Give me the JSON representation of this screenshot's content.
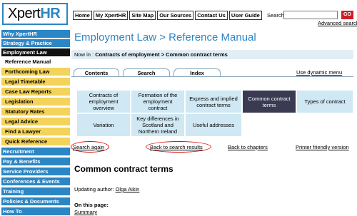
{
  "header": {
    "logo_prefix": "Xpert",
    "logo_suffix": "HR",
    "nav": [
      "Home",
      "My XpertHR",
      "Site Map",
      "Our Sources",
      "Contact Us",
      "User Guide"
    ],
    "search_label": "Search",
    "search_value": "",
    "go_label": "GO",
    "advanced_search": "Advanced search"
  },
  "sidebar": {
    "items": [
      {
        "label": "Why XpertHR",
        "style": "blue"
      },
      {
        "label": "Strategy & Practice",
        "style": "blue"
      },
      {
        "label": "Employment Law",
        "style": "dark"
      },
      {
        "label": "Reference Manual",
        "style": "sub-white"
      },
      {
        "label": "Forthcoming Law",
        "style": "sub-yellow"
      },
      {
        "label": "Legal Timetable",
        "style": "sub-yellow"
      },
      {
        "label": "Case Law Reports",
        "style": "sub-yellow"
      },
      {
        "label": "Legislation",
        "style": "sub-yellow"
      },
      {
        "label": "Statutory Rates",
        "style": "sub-yellow"
      },
      {
        "label": "Legal Advice",
        "style": "sub-yellow"
      },
      {
        "label": "Find a Lawyer",
        "style": "sub-yellow"
      },
      {
        "label": "Quick Reference",
        "style": "sub-yellow"
      },
      {
        "label": "Recruitment",
        "style": "blue"
      },
      {
        "label": "Pay & Benefits",
        "style": "blue"
      },
      {
        "label": "Service Providers",
        "style": "blue"
      },
      {
        "label": "Conferences & Events",
        "style": "blue"
      },
      {
        "label": "Training",
        "style": "blue"
      },
      {
        "label": "Policies & Documents",
        "style": "blue"
      },
      {
        "label": "How To",
        "style": "blue"
      }
    ]
  },
  "main": {
    "title": "Employment Law > Reference Manual",
    "breadcrumb_prefix": "Now in :",
    "breadcrumb_path": "Contracts of employment  >  Common contract terms",
    "tabs": [
      "Contents",
      "Search",
      "Index"
    ],
    "dynamic_menu": "Use dynamic menu",
    "grid": [
      "Contracts of employment overview",
      "Formation of the employment contract",
      "Express and implied contract terms",
      "Common contract terms",
      "Types of contract",
      "Variation",
      "Key differences in Scotland and Northern Ireland",
      "Useful addresses"
    ],
    "links": {
      "search_again": "Search again",
      "back_results": "Back to search results",
      "back_chapters": "Back to chapters",
      "printer": "Printer friendly version"
    },
    "heading": "Common contract terms",
    "author_label": "Updating author:",
    "author_name": "Olga Aikin",
    "on_this_page": "On this page:",
    "summary": "Summary"
  },
  "colors": {
    "brand_blue": "#2b86c5",
    "highlight_yellow": "#f3d35a",
    "cell_blue": "#cfe8f3",
    "active_cell": "#3a3a52",
    "annotation_red": "#dd1111",
    "go_red": "#cc1f26"
  }
}
